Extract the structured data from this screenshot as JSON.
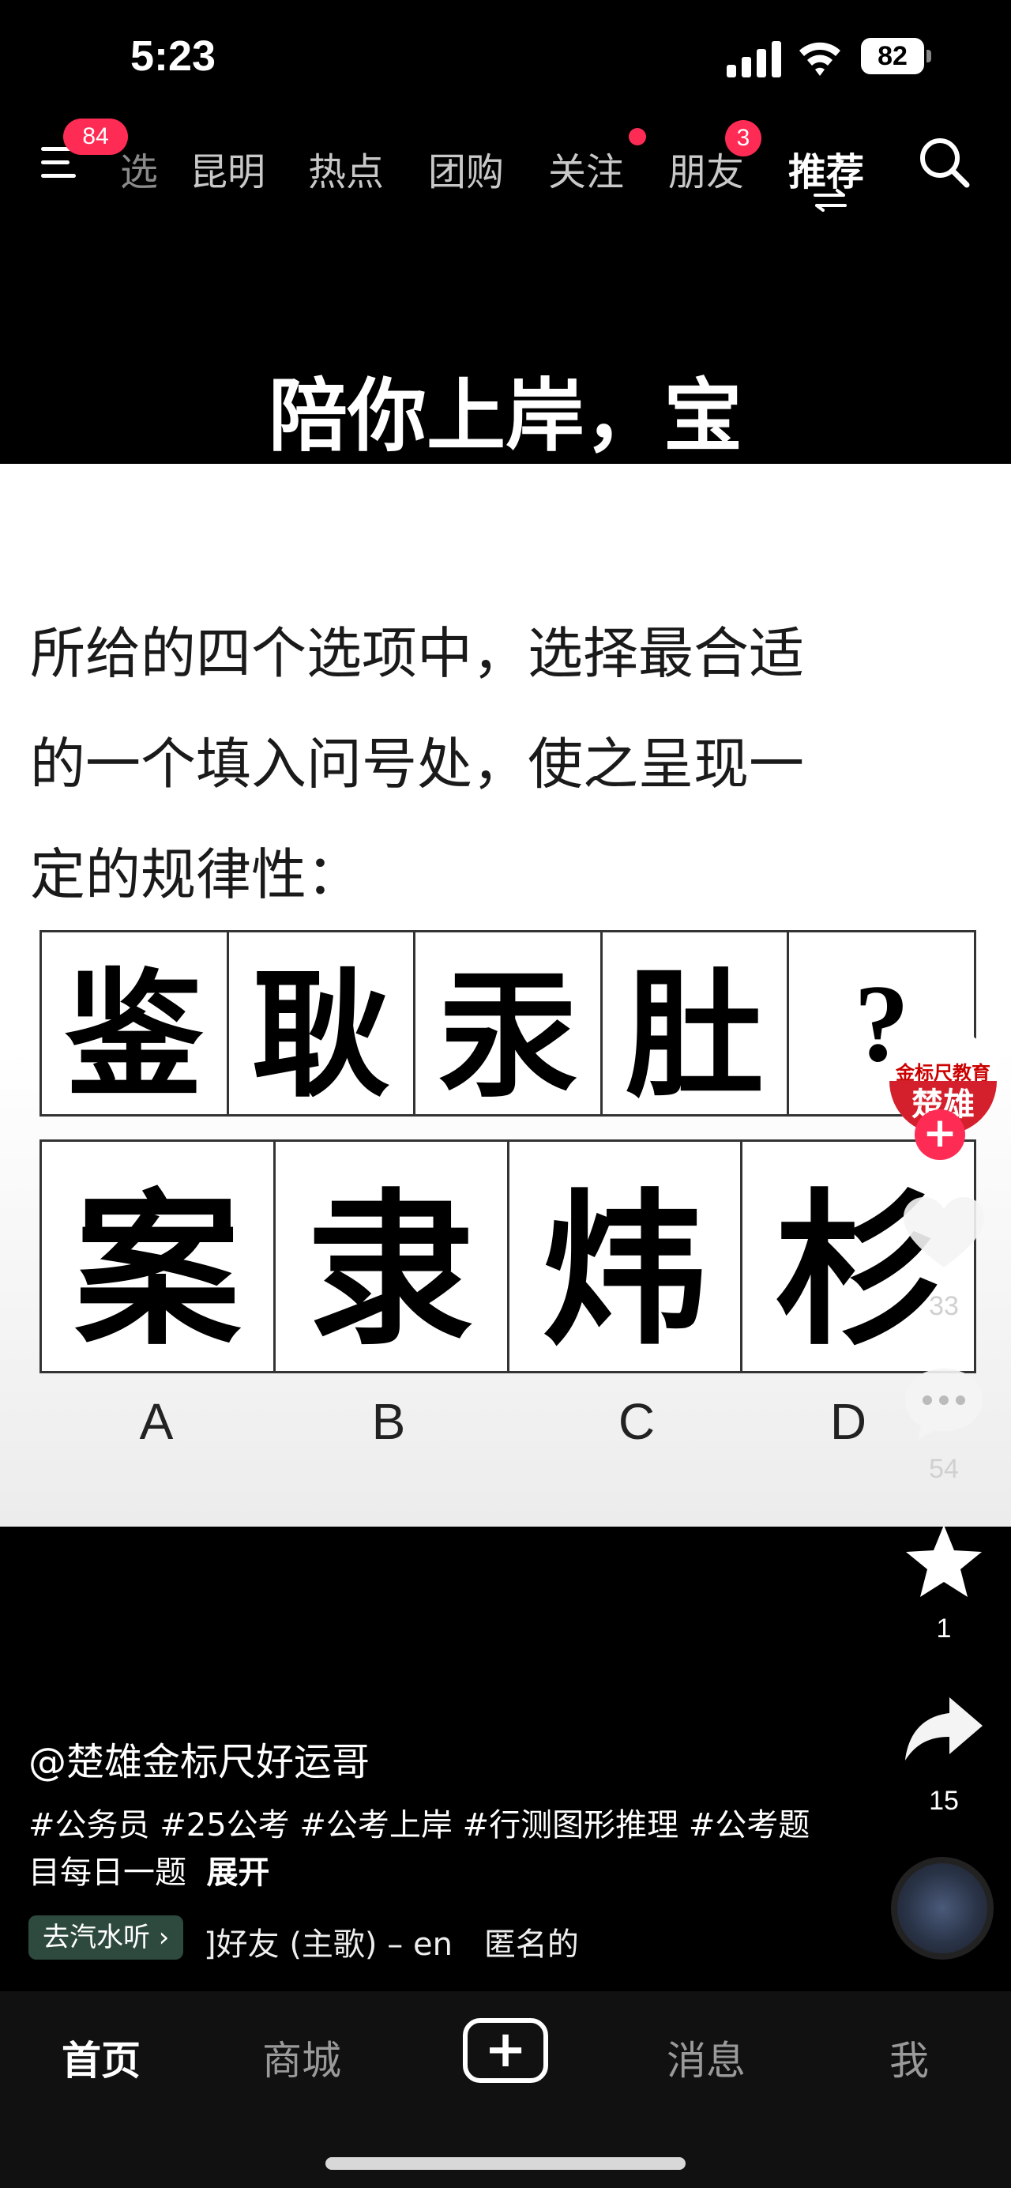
{
  "status_bar": {
    "time": "5:23",
    "battery": "82"
  },
  "top_nav": {
    "menu_badge": "84",
    "tabs": [
      "选",
      "昆明",
      "热点",
      "团购",
      "关注",
      "朋友",
      "推荐"
    ],
    "friends_badge": "3"
  },
  "video": {
    "caption": "陪你上岸，宝",
    "question_lines": [
      "所给的四个选项中，选择最合适",
      "的一个填入问号处，使之呈现一",
      "定的规律性："
    ],
    "sequence": [
      "鉴",
      "耿",
      "汞",
      "肚",
      "?"
    ],
    "options": [
      "案",
      "隶",
      "炜",
      "杉"
    ],
    "option_labels": [
      "A",
      "B",
      "C",
      "D"
    ]
  },
  "creator": {
    "logo_text": "金标尺教育",
    "logo_sub": "楚雄",
    "follow_symbol": "+"
  },
  "actions": {
    "likes": "33",
    "comments": "54",
    "favorites": "1",
    "shares": "15"
  },
  "info": {
    "author": "@楚雄金标尺好运哥",
    "description": "#公务员 #25公考 #公考上岸 #行测图形推理 #公考题目每日一题",
    "expand": "展开",
    "music_chip": "去汽水听 ›",
    "music_title": "]好友 (主歌) – en　匿名的"
  },
  "tab_bar": {
    "home": "首页",
    "mall": "商城",
    "create": "+",
    "messages": "消息",
    "me": "我"
  },
  "colors": {
    "accent": "#fe2c55",
    "background": "#000000"
  }
}
